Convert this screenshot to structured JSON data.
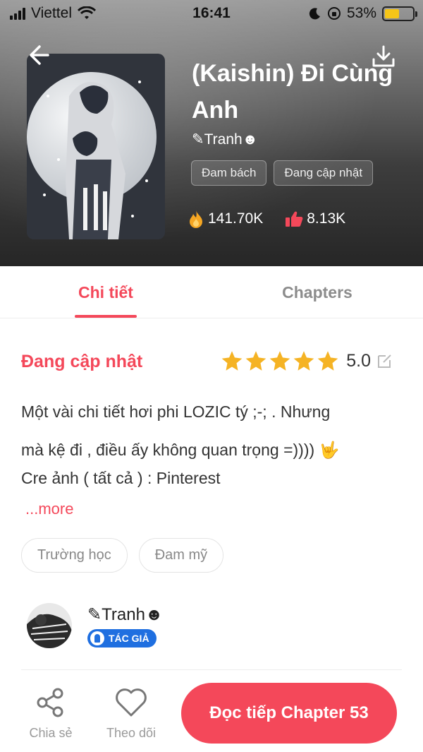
{
  "status_bar": {
    "carrier": "Viettel",
    "time": "16:41",
    "battery_percent": "53%",
    "battery_level": 0.53
  },
  "story": {
    "title": "(Kaishin) Đi Cùng Anh",
    "author": "✎Tranh☻",
    "tags": [
      "Đam bách",
      "Đang cập nhật"
    ],
    "views": "141.70K",
    "likes": "8.13K"
  },
  "tabs": [
    "Chi tiết",
    "Chapters"
  ],
  "detail": {
    "status": "Đang cập nhật",
    "rating": "5.0",
    "stars": 5,
    "description_lines": [
      "Một vài chi tiết hơi phi LOZIC tý ;-; . Nhưng",
      "mà kệ đi , điều ấy không quan trọng =)))) 🤟",
      "Cre ảnh ( tất cả ) : Pinterest"
    ],
    "more_label": "...more",
    "chips": [
      "Trường học",
      "Đam mỹ"
    ],
    "author_name": "✎Tranh☻",
    "author_badge": "TÁC GIẢ"
  },
  "bottom_bar": {
    "share_label": "Chia sẻ",
    "follow_label": "Theo dõi",
    "read_button": "Đọc tiếp Chapter 53"
  },
  "colors": {
    "accent": "#f4485a",
    "star": "#f5b324",
    "badge": "#1f6fe0"
  },
  "icons": [
    "back-arrow-icon",
    "download-icon",
    "fire-icon",
    "thumbs-up-icon",
    "star-icon",
    "edit-icon",
    "share-icon",
    "heart-icon"
  ]
}
